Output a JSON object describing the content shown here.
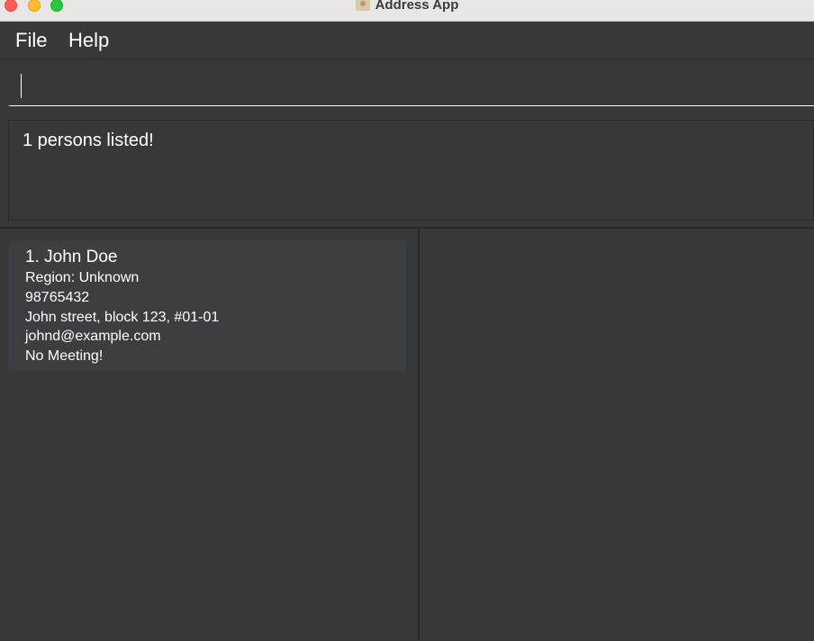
{
  "window": {
    "title": "Address App",
    "icon": "contacts-app-icon"
  },
  "menu": {
    "file": "File",
    "help": "Help"
  },
  "command": {
    "value": "",
    "placeholder": ""
  },
  "result": {
    "message": "1 persons listed!"
  },
  "persons": [
    {
      "index_name": "1.  John Doe",
      "region": "Region: Unknown",
      "phone": "98765432",
      "address": "John street, block 123, #01-01",
      "email": "johnd@example.com",
      "meeting": "No Meeting!"
    }
  ],
  "colors": {
    "background": "#383838",
    "card": "#3c3f41",
    "text": "#ffffff",
    "close": "#fe5f57",
    "minimize": "#febc2e",
    "maximize": "#28c840"
  }
}
